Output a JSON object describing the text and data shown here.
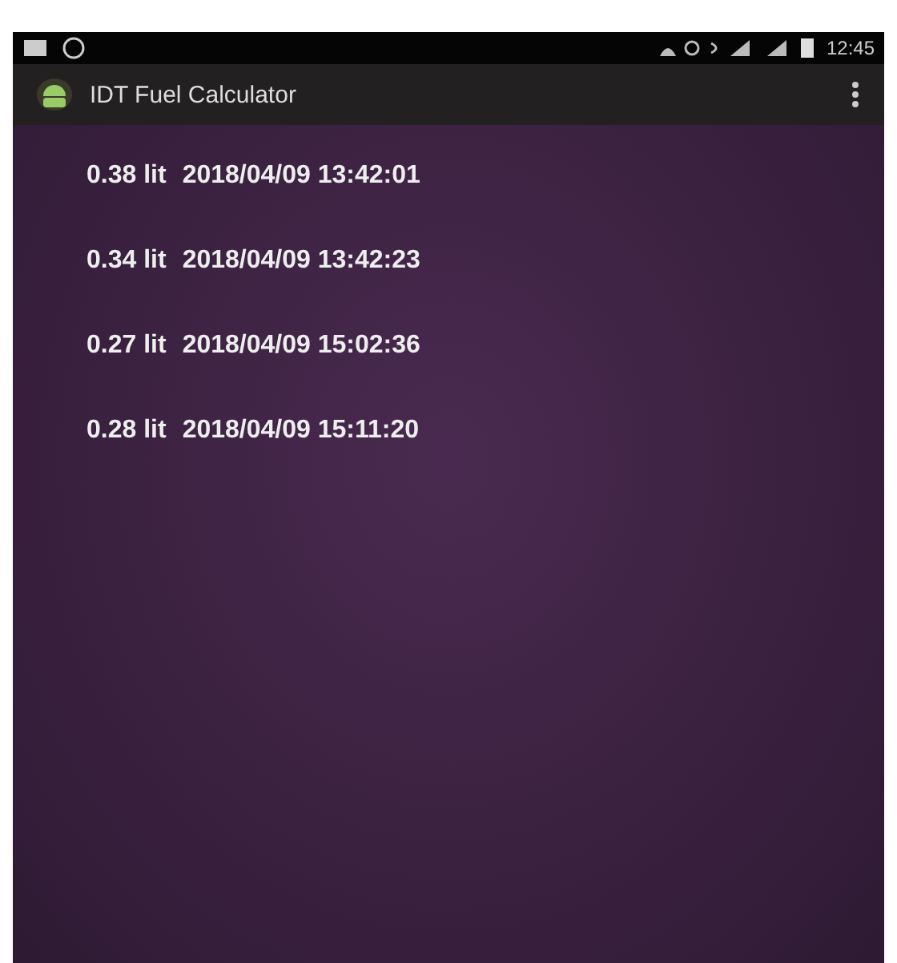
{
  "status_bar": {
    "time": "12:45"
  },
  "app_bar": {
    "title": "IDT Fuel Calculator"
  },
  "records": [
    {
      "amount": "0.38 lit",
      "timestamp": "2018/04/09 13:42:01"
    },
    {
      "amount": "0.34 lit",
      "timestamp": "2018/04/09 13:42:23"
    },
    {
      "amount": "0.27 lit",
      "timestamp": "2018/04/09 15:02:36"
    },
    {
      "amount": "0.28 lit",
      "timestamp": "2018/04/09 15:11:20"
    }
  ]
}
